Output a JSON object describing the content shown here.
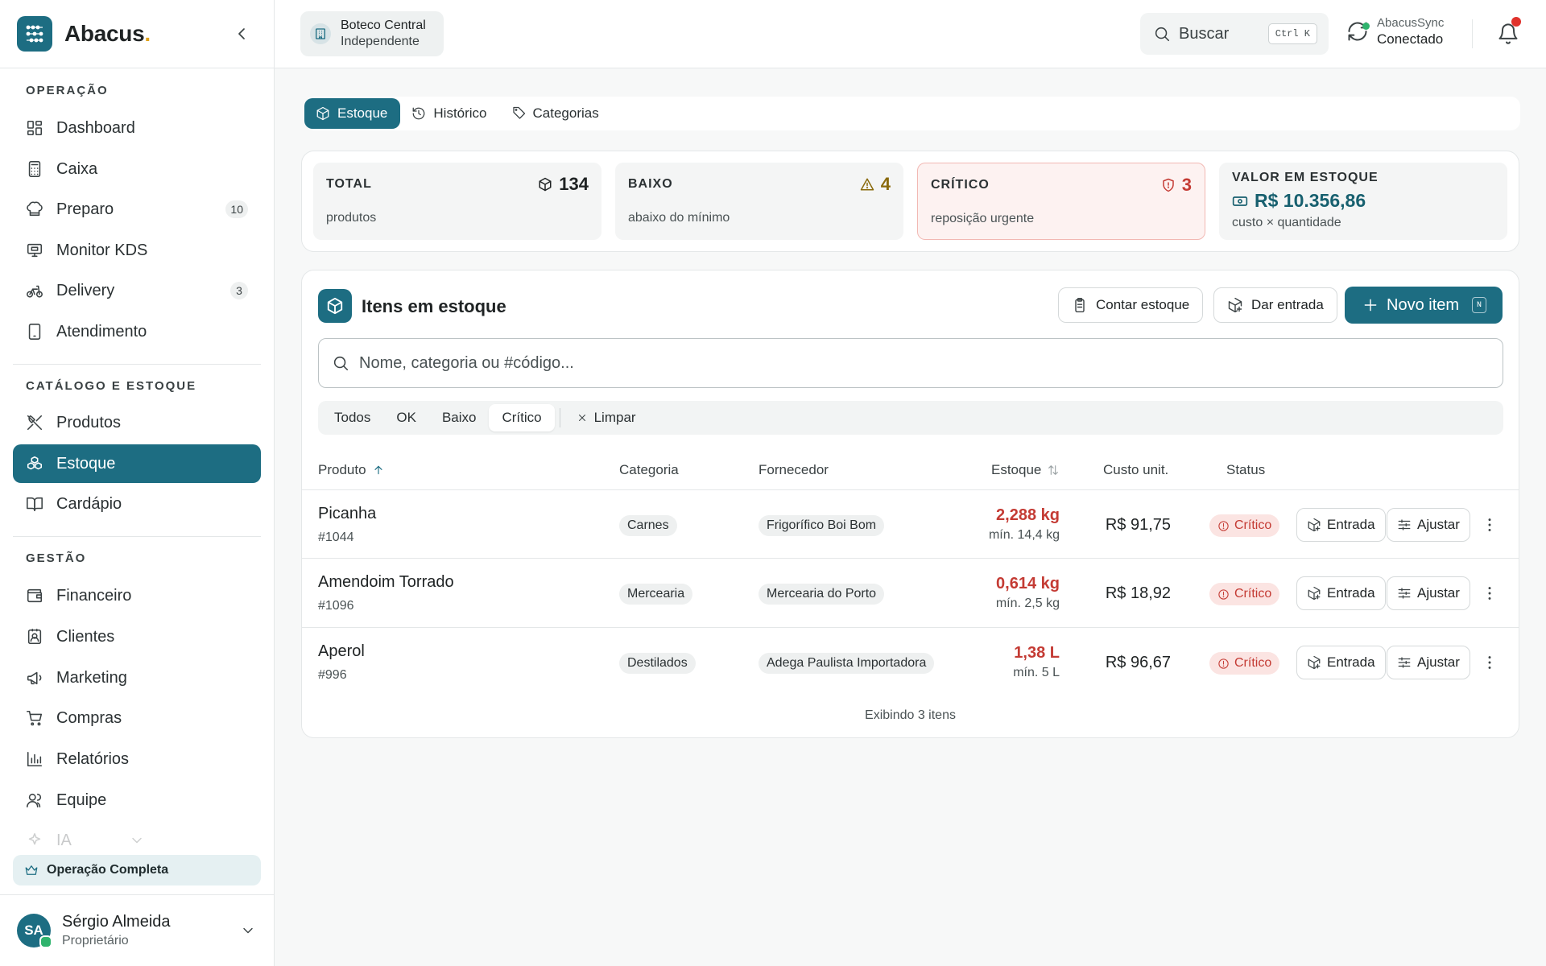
{
  "brand": {
    "name": "Abacus",
    "dot": "."
  },
  "sidebar": {
    "sections": [
      {
        "title": "OPERAÇÃO"
      },
      {
        "title": "CATÁLOGO E ESTOQUE"
      },
      {
        "title": "GESTÃO"
      }
    ],
    "items": [
      {
        "label": "Dashboard"
      },
      {
        "label": "Caixa"
      },
      {
        "label": "Preparo",
        "badge": "10"
      },
      {
        "label": "Monitor KDS"
      },
      {
        "label": "Delivery",
        "badge": "3"
      },
      {
        "label": "Atendimento"
      },
      {
        "label": "Produtos"
      },
      {
        "label": "Estoque"
      },
      {
        "label": "Cardápio"
      },
      {
        "label": "Financeiro"
      },
      {
        "label": "Clientes"
      },
      {
        "label": "Marketing"
      },
      {
        "label": "Compras"
      },
      {
        "label": "Relatórios"
      },
      {
        "label": "Equipe"
      },
      {
        "label": "IA"
      }
    ],
    "plan": "Operação Completa",
    "user": {
      "initials": "SA",
      "name": "Sérgio Almeida",
      "role": "Proprietário"
    }
  },
  "topbar": {
    "store": {
      "name": "Boteco Central",
      "type": "Independente"
    },
    "search": {
      "label": "Buscar",
      "shortcut": "Ctrl K"
    },
    "sync": {
      "name": "AbacusSync",
      "status": "Conectado"
    }
  },
  "tabs": [
    {
      "label": "Estoque"
    },
    {
      "label": "Histórico"
    },
    {
      "label": "Categorias"
    }
  ],
  "stats": {
    "total": {
      "title": "TOTAL",
      "sub": "produtos",
      "value": "134"
    },
    "low": {
      "title": "BAIXO",
      "sub": "abaixo do mínimo",
      "value": "4"
    },
    "critical": {
      "title": "CRÍTICO",
      "sub": "reposição urgente",
      "value": "3"
    },
    "value": {
      "title": "VALOR EM ESTOQUE",
      "amount": "R$ 10.356,86",
      "sub": "custo × quantidade"
    }
  },
  "panel": {
    "title": "Itens em estoque",
    "count_button": "Contar estoque",
    "entry_button": "Dar entrada",
    "new_button": "Novo item",
    "new_shortcut": "N",
    "search_placeholder": "Nome, categoria ou #código...",
    "filters": [
      "Todos",
      "OK",
      "Baixo",
      "Crítico"
    ],
    "clear": "Limpar",
    "columns": {
      "product": "Produto",
      "category": "Categoria",
      "supplier": "Fornecedor",
      "stock": "Estoque",
      "cost": "Custo unit.",
      "status": "Status"
    },
    "rows": [
      {
        "name": "Picanha",
        "code": "#1044",
        "category": "Carnes",
        "supplier": "Frigorífico Boi Bom",
        "qty": "2,288 kg",
        "min": "mín. 14,4 kg",
        "cost": "R$ 91,75",
        "status": "Crítico",
        "entry": "Entrada",
        "adjust": "Ajustar"
      },
      {
        "name": "Amendoim Torrado",
        "code": "#1096",
        "category": "Mercearia",
        "supplier": "Mercearia do Porto",
        "qty": "0,614 kg",
        "min": "mín. 2,5 kg",
        "cost": "R$ 18,92",
        "status": "Crítico",
        "entry": "Entrada",
        "adjust": "Ajustar"
      },
      {
        "name": "Aperol",
        "code": "#996",
        "category": "Destilados",
        "supplier": "Adega Paulista Importadora",
        "qty": "1,38 L",
        "min": "mín. 5 L",
        "cost": "R$ 96,67",
        "status": "Crítico",
        "entry": "Entrada",
        "adjust": "Ajustar"
      }
    ],
    "footer": "Exibindo 3 itens"
  },
  "colors": {
    "primary": "#1d6d82",
    "critical": "#c43b34",
    "warning": "#a07a10",
    "online": "#2fb36d"
  }
}
